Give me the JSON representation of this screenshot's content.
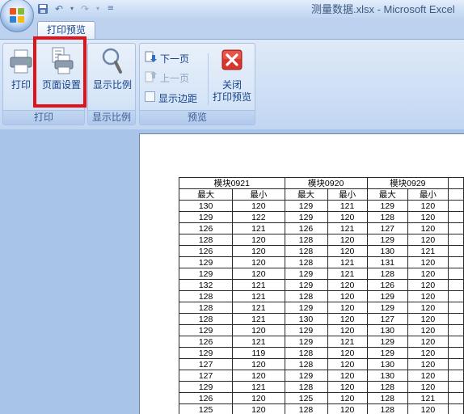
{
  "window": {
    "title": "测量数据.xlsx - Microsoft Excel"
  },
  "tabs": [
    {
      "label": "打印预览"
    }
  ],
  "ribbon": {
    "groups": [
      {
        "label": "打印",
        "buttons": [
          {
            "label": "打印"
          },
          {
            "label": "页面设置"
          }
        ]
      },
      {
        "label": "显示比例",
        "buttons": [
          {
            "label": "显示比例"
          }
        ]
      },
      {
        "label": "预览",
        "small_buttons": [
          {
            "label": "下一页"
          },
          {
            "label": "上一页"
          },
          {
            "label": "显示边距"
          }
        ],
        "buttons": [
          {
            "label_line1": "关闭",
            "label_line2": "打印预览"
          }
        ]
      }
    ]
  },
  "sheet": {
    "headers": [
      "模块0921",
      "模块0920",
      "模块0929"
    ],
    "subheaders": [
      "最大",
      "最小",
      "最大",
      "最小",
      "最大",
      "最小"
    ],
    "rows": [
      [
        "130",
        "120",
        "129",
        "121",
        "129",
        "120"
      ],
      [
        "129",
        "122",
        "129",
        "120",
        "128",
        "120"
      ],
      [
        "126",
        "121",
        "126",
        "121",
        "127",
        "120"
      ],
      [
        "128",
        "120",
        "128",
        "120",
        "129",
        "120"
      ],
      [
        "126",
        "120",
        "128",
        "120",
        "130",
        "121"
      ],
      [
        "129",
        "120",
        "128",
        "121",
        "131",
        "120"
      ],
      [
        "129",
        "120",
        "129",
        "121",
        "128",
        "120"
      ],
      [
        "132",
        "121",
        "129",
        "120",
        "126",
        "120"
      ],
      [
        "128",
        "121",
        "128",
        "120",
        "129",
        "120"
      ],
      [
        "128",
        "121",
        "129",
        "120",
        "129",
        "120"
      ],
      [
        "128",
        "121",
        "130",
        "120",
        "127",
        "120"
      ],
      [
        "129",
        "120",
        "129",
        "120",
        "130",
        "120"
      ],
      [
        "126",
        "121",
        "129",
        "121",
        "129",
        "120"
      ],
      [
        "129",
        "119",
        "128",
        "120",
        "129",
        "120"
      ],
      [
        "127",
        "120",
        "128",
        "120",
        "130",
        "120"
      ],
      [
        "127",
        "120",
        "129",
        "120",
        "130",
        "120"
      ],
      [
        "129",
        "121",
        "128",
        "120",
        "128",
        "120"
      ],
      [
        "126",
        "120",
        "125",
        "120",
        "128",
        "121"
      ],
      [
        "125",
        "120",
        "128",
        "120",
        "128",
        "120"
      ]
    ]
  },
  "colors": {
    "highlight": "#e0131b",
    "ribbon": "#d6e5f7",
    "workarea": "#a8c4e8"
  }
}
